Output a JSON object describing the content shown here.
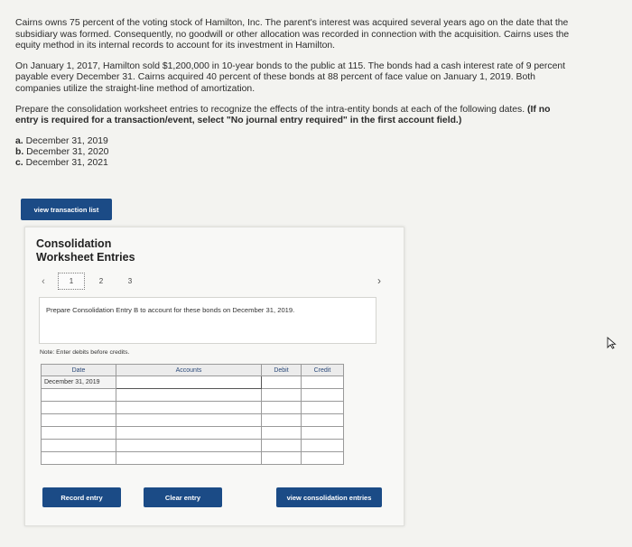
{
  "problem": {
    "paragraph1": "Cairns owns 75 percent of the voting stock of Hamilton, Inc. The parent's interest was acquired several years ago on the date that the subsidiary was formed. Consequently, no goodwill or other allocation was recorded in connection with the acquisition. Cairns uses the equity method in its internal records to account for its investment in Hamilton.",
    "paragraph2": "On January 1, 2017, Hamilton sold $1,200,000 in 10-year bonds to the public at 115. The bonds had a cash interest rate of 9 percent payable every December 31. Cairns acquired 40 percent of these bonds at 88 percent of face value on January 1, 2019. Both companies utilize the straight-line method of amortization.",
    "paragraph3_plain": "Prepare the consolidation worksheet entries to recognize the effects of the intra-entity bonds at each of the following dates.",
    "paragraph3_bold": "(If no entry is required for a transaction/event, select \"No journal entry required\" in the first account field.)",
    "parts": [
      {
        "letter": "a.",
        "text": "December 31, 2019"
      },
      {
        "letter": "b.",
        "text": "December 31, 2020"
      },
      {
        "letter": "c.",
        "text": "December 31, 2021"
      }
    ]
  },
  "buttons": {
    "view_transaction_list": "view transaction list",
    "record_entry": "Record entry",
    "clear_entry": "Clear entry",
    "view_consolidation_entries": "view consolidation entries"
  },
  "panel": {
    "title_line1": "Consolidation",
    "title_line2": "Worksheet Entries",
    "pages": [
      "1",
      "2",
      "3"
    ],
    "active_page": "1",
    "instruction": "Prepare Consolidation Entry B to account for these bonds on December 31, 2019.",
    "note": "Note: Enter debits before credits."
  },
  "table": {
    "headers": {
      "date": "Date",
      "accounts": "Accounts",
      "debit": "Debit",
      "credit": "Credit"
    },
    "rows": [
      {
        "date": "December 31, 2019",
        "account": "",
        "debit": "",
        "credit": ""
      },
      {
        "date": "",
        "account": "",
        "debit": "",
        "credit": ""
      },
      {
        "date": "",
        "account": "",
        "debit": "",
        "credit": ""
      },
      {
        "date": "",
        "account": "",
        "debit": "",
        "credit": ""
      },
      {
        "date": "",
        "account": "",
        "debit": "",
        "credit": ""
      },
      {
        "date": "",
        "account": "",
        "debit": "",
        "credit": ""
      },
      {
        "date": "",
        "account": "",
        "debit": "",
        "credit": ""
      }
    ]
  },
  "colors": {
    "button_blue": "#1b4b86",
    "header_text": "#2c4a7a"
  }
}
